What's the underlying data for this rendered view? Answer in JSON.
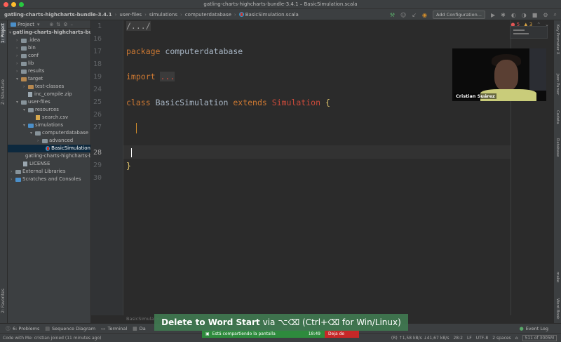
{
  "window": {
    "title": "gatling-charts-highcharts-bundle-3.4.1 – BasicSimulation.scala"
  },
  "navbar": {
    "crumbs": [
      "gatling-charts-highcharts-bundle-3.4.1",
      "user-files",
      "simulations",
      "computerdatabase",
      "BasicSimulation.scala"
    ],
    "add_configuration": "Add Configuration..."
  },
  "left_strip": {
    "project_tab": "1: Project",
    "structure_tab": "Z: Structure",
    "favorites_tab": "2: Favorites"
  },
  "right_strip": {
    "tabs": [
      "Key Promoter X",
      "Json Parser",
      "Codota",
      "Database",
      "make",
      "Word Book"
    ]
  },
  "project_panel": {
    "header": "Project",
    "tree": [
      {
        "label": "gatling-charts-highcharts-bundle-3.4.1",
        "kind": "root"
      },
      {
        "label": ".idea",
        "kind": "folder"
      },
      {
        "label": "bin",
        "kind": "folder"
      },
      {
        "label": "conf",
        "kind": "folder"
      },
      {
        "label": "lib",
        "kind": "folder"
      },
      {
        "label": "results",
        "kind": "folder"
      },
      {
        "label": "target",
        "kind": "folder-open"
      },
      {
        "label": "test-classes",
        "kind": "folder"
      },
      {
        "label": "inc_compile.zip",
        "kind": "file"
      },
      {
        "label": "user-files",
        "kind": "folder-open"
      },
      {
        "label": "resources",
        "kind": "folder-open"
      },
      {
        "label": "search.csv",
        "kind": "csv"
      },
      {
        "label": "simulations",
        "kind": "folder-open"
      },
      {
        "label": "computerdatabase",
        "kind": "folder-open"
      },
      {
        "label": "advanced",
        "kind": "folder"
      },
      {
        "label": "BasicSimulation",
        "kind": "scala"
      },
      {
        "label": "gatling-charts-highcharts-bundle-3.4.1.iml",
        "kind": "file"
      },
      {
        "label": "LICENSE",
        "kind": "file"
      },
      {
        "label": "External Libraries",
        "kind": "lib"
      },
      {
        "label": "Scratches and Consoles",
        "kind": "scratch"
      }
    ]
  },
  "editor": {
    "lines": [
      "1",
      "16",
      "17",
      "18",
      "19",
      "24",
      "25",
      "26",
      "27",
      "28",
      "29",
      "30"
    ],
    "current_line": "28",
    "fold_text": "/.../",
    "package_kw": "package",
    "package_name": "computerdatabase",
    "import_kw": "import",
    "import_fold": "...",
    "class_kw": "class",
    "class_name": "BasicSimulation",
    "extends_kw": "extends",
    "parent_class": "Simulation",
    "open_brace": "{",
    "close_brace": "}",
    "errors": "5",
    "warnings": "3",
    "bottom_tab": "BasicSimulation"
  },
  "webcam": {
    "name": "Cristian Suárez"
  },
  "bottom_tabs": {
    "problems": "6: Problems",
    "sequence": "Sequence Diagram",
    "terminal": "Terminal",
    "db": "Da",
    "event_log": "Event Log"
  },
  "key_hint": {
    "action": "Delete to Word Start",
    "via": "via",
    "shortcut": "⌥⌫ (Ctrl+⌫ for Win/Linux)"
  },
  "share": {
    "text": "Está compartiendo la pantalla",
    "time": "18:49",
    "stop": "Deja de"
  },
  "status": {
    "left": "Code with Me: cristian joined (11 minutes ago)",
    "net": "(R) ↑1,58 kB/s ↓41,67 kB/s",
    "pos": "28:2",
    "lf": "LF",
    "enc": "UTF-8",
    "indent": "2 spaces",
    "mem": "511 of 3005M"
  },
  "colors": {
    "keyword": "#cc7832",
    "class_ref": "#cb4a3a",
    "brace": "#e0c46c",
    "share_green": "#2e8b3d",
    "share_red": "#c62828"
  }
}
